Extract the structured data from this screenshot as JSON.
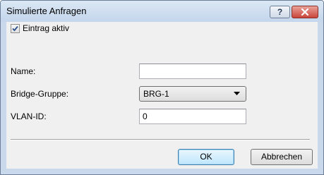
{
  "window": {
    "title": "Simulierte Anfragen",
    "help_label": "?",
    "close_icon": "close-icon"
  },
  "form": {
    "entry_active": {
      "label": "Eintrag aktiv",
      "checked": true
    },
    "name": {
      "label": "Name:",
      "value": ""
    },
    "bridge_group": {
      "label": "Bridge-Gruppe:",
      "value": "BRG-1"
    },
    "vlan_id": {
      "label": "VLAN-ID:",
      "value": "0"
    }
  },
  "buttons": {
    "ok": "OK",
    "cancel": "Abbrechen"
  }
}
